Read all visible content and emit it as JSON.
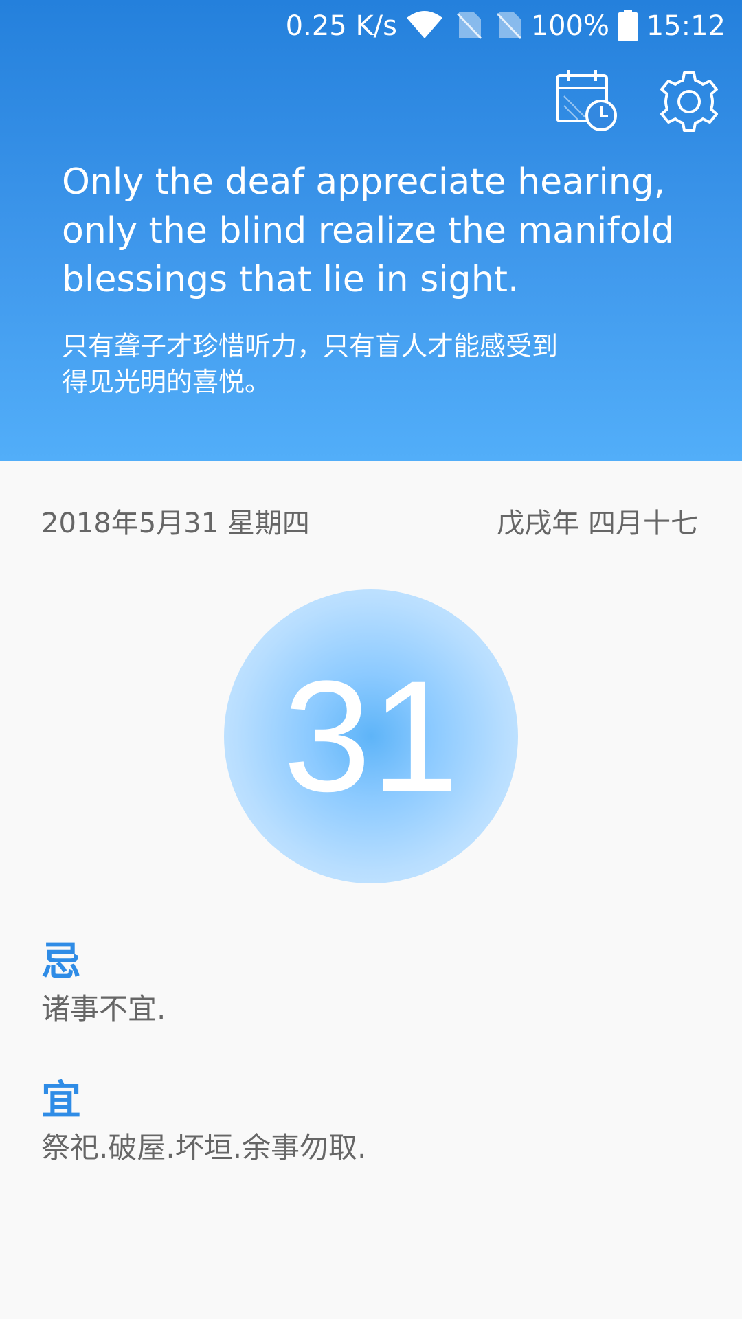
{
  "status_bar": {
    "network_speed": "0.25 K/s",
    "battery_percent": "100%",
    "time": "15:12",
    "icons": [
      "wifi-icon",
      "no-sim-icon",
      "no-sim-icon",
      "battery-full-icon"
    ]
  },
  "toolbar": {
    "icons": [
      "calendar-clock-icon",
      "gear-icon"
    ]
  },
  "quote": {
    "english": "Only the deaf appreciate hearing,\nonly the blind realize the manifold\nblessings that lie  in sight.",
    "chinese": "只有聋子才珍惜听力，只有盲人才能感受到\n得见光明的喜悦。"
  },
  "date": {
    "gregorian": "2018年5月31 星期四",
    "lunar": "戊戌年 四月十七",
    "day": "31"
  },
  "almanac": {
    "avoid_label": "忌",
    "avoid_text": "诸事不宜.",
    "suitable_label": "宜",
    "suitable_text": "祭祀.破屋.坏垣.余事勿取."
  },
  "colors": {
    "header_top": "#2480dc",
    "header_bottom": "#52aef9",
    "accent": "#2f8ce6",
    "text_gray": "#666666",
    "background": "#f9f9f9"
  }
}
